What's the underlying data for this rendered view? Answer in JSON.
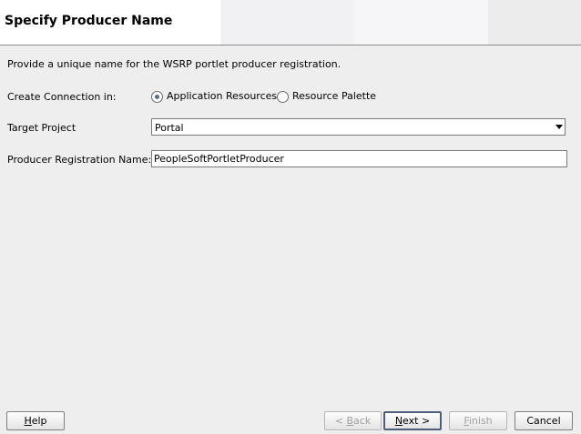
{
  "header": {
    "title": "Specify Producer Name"
  },
  "description": "Provide a unique name for the WSRP portlet producer registration.",
  "connection": {
    "label": "Create Connection in:",
    "options": [
      {
        "label": "Application Resources",
        "selected": true
      },
      {
        "label": "Resource Palette",
        "selected": false
      }
    ]
  },
  "target_project": {
    "label": "Target Project",
    "selected_value": "Portal"
  },
  "registration_name": {
    "label": "Producer Registration Name:",
    "value": "PeopleSoftPortletProducer"
  },
  "buttons": {
    "help": {
      "mnemonic": "H",
      "rest": "elp"
    },
    "back": {
      "prefix": "< ",
      "mnemonic": "B",
      "rest": "ack",
      "enabled": false
    },
    "next": {
      "mnemonic": "N",
      "rest": "ext >",
      "enabled": true
    },
    "finish": {
      "mnemonic": "F",
      "rest": "inish",
      "enabled": false
    },
    "cancel": {
      "label": "Cancel"
    }
  },
  "colors": {
    "background": "#eeeeee",
    "radio_dot": "#5a6d86",
    "focus_border": "#4f5e78",
    "disabled_text": "#a2a2a2"
  }
}
